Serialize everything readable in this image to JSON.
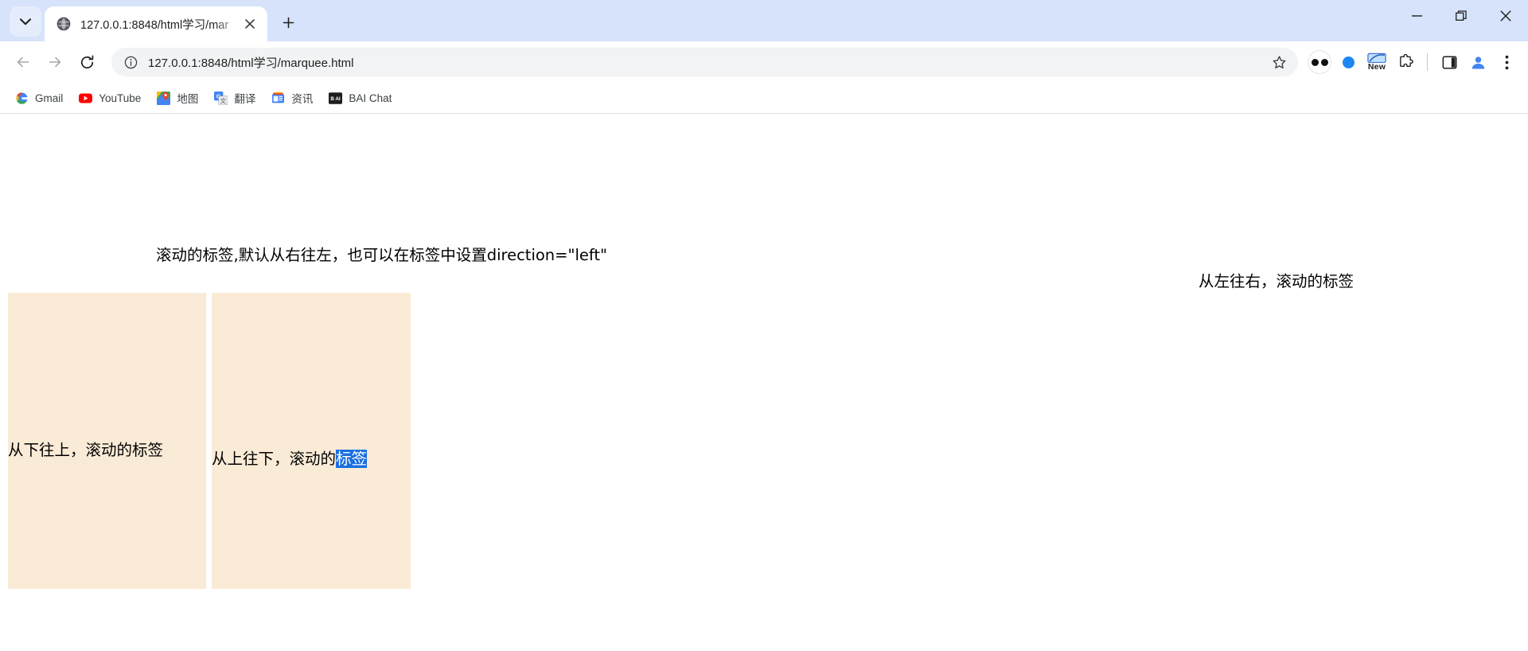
{
  "window": {
    "controls": {
      "minimize": "minimize-window",
      "maximize": "restore-window",
      "close": "close-window"
    }
  },
  "tabstrip": {
    "tab_search_label": "Search tabs",
    "new_tab_label": "New Tab",
    "tabs": [
      {
        "title": "127.0.0.1:8848/html学习/mar",
        "favicon": "globe-icon",
        "active": true,
        "close_label": "Close"
      }
    ]
  },
  "toolbar": {
    "back_label": "Back",
    "forward_label": "Forward",
    "reload_label": "Reload",
    "site_info_label": "View site information",
    "url": "127.0.0.1:8848/html学习/marquee.html",
    "bookmark_label": "Bookmark this tab",
    "extensions_label": "Extensions",
    "side_panel_label": "Side panel",
    "profile_label": "Profile",
    "menu_label": "Customize and control Google Chrome",
    "ext_new_badge": "New"
  },
  "bookmarks": {
    "items": [
      {
        "label": "Gmail",
        "icon": "gmail-icon"
      },
      {
        "label": "YouTube",
        "icon": "youtube-icon"
      },
      {
        "label": "地图",
        "icon": "google-maps-icon"
      },
      {
        "label": "翻译",
        "icon": "google-translate-icon"
      },
      {
        "label": "资讯",
        "icon": "google-news-icon"
      },
      {
        "label": "BAI Chat",
        "icon": "bai-chat-icon"
      }
    ]
  },
  "page": {
    "marquee_default": "滚动的标签,默认从右往左，也可以在标签中设置direction=\"left\"",
    "marquee_right": "从左往右，滚动的标签",
    "marquee_up": "从下往上，滚动的标签",
    "marquee_down_prefix": "从上往下，滚动的",
    "marquee_down_selected": "标签",
    "box_background": "#faebd7",
    "selection_color": "#1a6fe0"
  }
}
